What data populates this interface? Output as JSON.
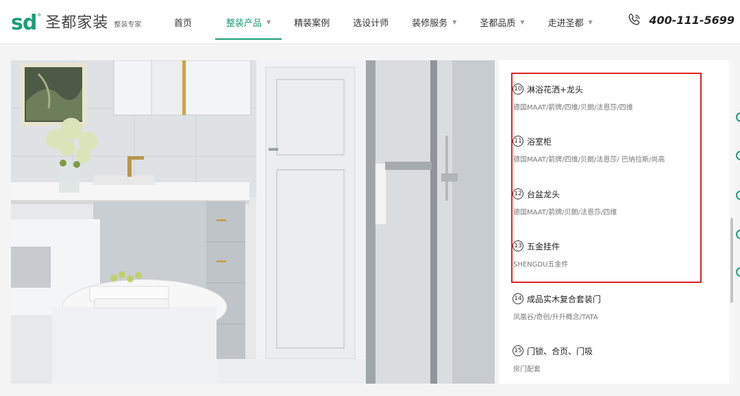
{
  "header": {
    "logo_mark": "sd",
    "logo_degree": "°",
    "logo_name": "圣都家装",
    "logo_tagline": "整装专家",
    "nav": [
      {
        "label": "首页",
        "dropdown": false,
        "active": false
      },
      {
        "label": "整装产品",
        "dropdown": true,
        "active": true
      },
      {
        "label": "精装案例",
        "dropdown": false,
        "active": false
      },
      {
        "label": "选设计师",
        "dropdown": false,
        "active": false
      },
      {
        "label": "装修服务",
        "dropdown": true,
        "active": false
      },
      {
        "label": "圣都品质",
        "dropdown": true,
        "active": false
      },
      {
        "label": "走进圣都",
        "dropdown": true,
        "active": false
      }
    ],
    "caret": "▼",
    "phone": "400-111-5699"
  },
  "products": [
    {
      "num": "10",
      "name": "淋浴花洒+龙头",
      "brands": "德国MAAT/箭牌/四维/贝朗/法恩莎/四维"
    },
    {
      "num": "11",
      "name": "浴室柜",
      "brands": "德国MAAT/箭牌/四维/贝朗/法恩莎/ 巴纳拉斯/尚高"
    },
    {
      "num": "12",
      "name": "台盆龙头",
      "brands": "德国MAAT/箭牌/贝朗/法恩莎/四维"
    },
    {
      "num": "13",
      "name": "五金挂件",
      "brands": "SHENGDU五金件"
    },
    {
      "num": "14",
      "name": "成品实木复合套装门",
      "brands": "凤凰谷/奇创/升升概念/TATA"
    },
    {
      "num": "15",
      "name": "门锁、合页、门吸",
      "brands": "房门配套"
    }
  ],
  "colors": {
    "brand_green": "#1a9e76",
    "highlight_red": "#e02020"
  },
  "icons": {
    "phone": "phone-icon"
  }
}
